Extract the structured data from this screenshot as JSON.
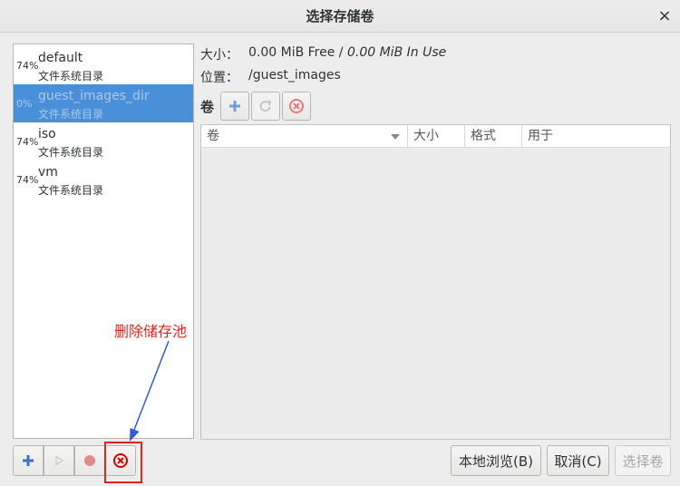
{
  "window": {
    "title": "选择存储卷",
    "close_glyph": "×"
  },
  "pools": [
    {
      "percent": "74%",
      "name": "default",
      "type": "文件系统目录",
      "selected": false
    },
    {
      "percent": "0%",
      "name": "guest_images_dir",
      "type": "文件系统目录",
      "selected": true
    },
    {
      "percent": "74%",
      "name": "iso",
      "type": "文件系统目录",
      "selected": false
    },
    {
      "percent": "74%",
      "name": "vm",
      "type": "文件系统目录",
      "selected": false
    }
  ],
  "info": {
    "size_label": "大小：",
    "size_free": "0.00 MiB Free /",
    "size_in_use": "0.00 MiB In Use",
    "location_label": "位置：",
    "location_value": "/guest_images"
  },
  "volumes": {
    "label": "卷",
    "columns": [
      "卷",
      "大小",
      "格式",
      "用于"
    ],
    "rows": []
  },
  "pool_toolbar": {
    "add_icon": "plus-icon",
    "start_icon": "play-icon",
    "stop_icon": "stop-record-icon",
    "delete_icon": "delete-circle-icon"
  },
  "annotation": {
    "text": "删除储存池",
    "color": "#e0241b"
  },
  "buttons": {
    "browse": "本地浏览(B)",
    "cancel": "取消(C)",
    "choose": "选择卷"
  },
  "colors": {
    "selection": "#4a90d9",
    "add_blue": "#3b74c7",
    "delete_red": "#cc0000"
  }
}
